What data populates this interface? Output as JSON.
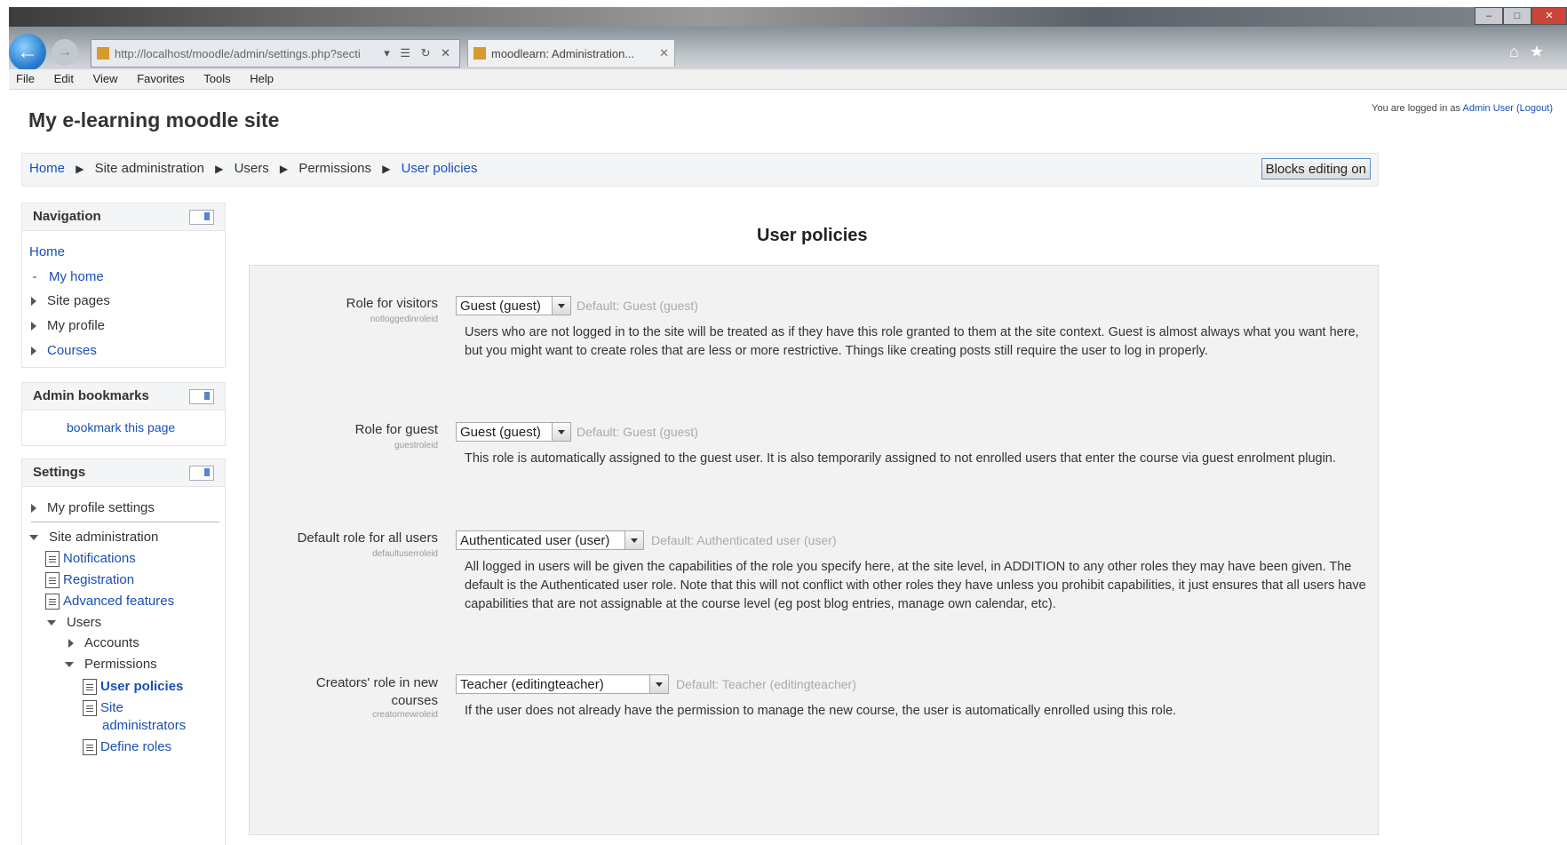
{
  "browser": {
    "address": "http://localhost/moodle/admin/settings.php?secti",
    "tab_label": "moodlearn: Administration...",
    "menu": [
      "File",
      "Edit",
      "View",
      "Favorites",
      "Tools",
      "Help"
    ]
  },
  "header": {
    "site_title": "My e-learning moodle site",
    "login_prefix": "You are logged in as",
    "login_user": "Admin User",
    "logout": "(Logout)"
  },
  "breadcrumb": {
    "items": [
      "Home",
      "Site administration",
      "Users",
      "Permissions",
      "User policies"
    ],
    "separator": "▶",
    "blocks_button": "Blocks editing on"
  },
  "navigation": {
    "title": "Navigation",
    "home": "Home",
    "my_home": "My home",
    "site_pages": "Site pages",
    "my_profile": "My profile",
    "courses": "Courses"
  },
  "admin_bookmarks": {
    "title": "Admin bookmarks",
    "bookmark_link": "bookmark this page"
  },
  "settings": {
    "title": "Settings",
    "my_profile_settings": "My profile settings",
    "site_admin": "Site administration",
    "notifications": "Notifications",
    "registration": "Registration",
    "advanced_features": "Advanced features",
    "users": "Users",
    "accounts": "Accounts",
    "permissions": "Permissions",
    "user_policies": "User policies",
    "site_administrators_1": "Site",
    "site_administrators_2": "administrators",
    "define_roles": "Define roles"
  },
  "main": {
    "heading": "User policies",
    "rows": [
      {
        "label": "Role for visitors",
        "key": "notloggedinroleid",
        "value": "Guest (guest)",
        "default": "Default: Guest (guest)",
        "description": "Users who are not logged in to the site will be treated as if they have this role granted to them at the site context. Guest is almost always what you want here, but you might want to create roles that are less or more restrictive. Things like creating posts still require the user to log in properly."
      },
      {
        "label": "Role for guest",
        "key": "guestroleid",
        "value": "Guest (guest)",
        "default": "Default: Guest (guest)",
        "description": "This role is automatically assigned to the guest user. It is also temporarily assigned to not enrolled users that enter the course via guest enrolment plugin."
      },
      {
        "label": "Default role for all users",
        "key": "defaultuserroleid",
        "value": "Authenticated user (user)",
        "default": "Default: Authenticated user (user)",
        "description": "All logged in users will be given the capabilities of the role you specify here, at the site level, in ADDITION to any other roles they may have been given. The default is the Authenticated user role. Note that this will not conflict with other roles they have unless you prohibit capabilities, it just ensures that all users have capabilities that are not assignable at the course level (eg post blog entries, manage own calendar, etc)."
      },
      {
        "label_1": "Creators' role in new",
        "label_2": "courses",
        "key": "creatornewroleid",
        "value": "Teacher (editingteacher)",
        "default": "Default: Teacher (editingteacher)",
        "description": "If the user does not already have the permission to manage the new course, the user is automatically enrolled using this role."
      }
    ]
  },
  "colors": {
    "link": "#1a4fb5",
    "panel": "#f2f2f2",
    "muted": "#aaaaaa"
  }
}
